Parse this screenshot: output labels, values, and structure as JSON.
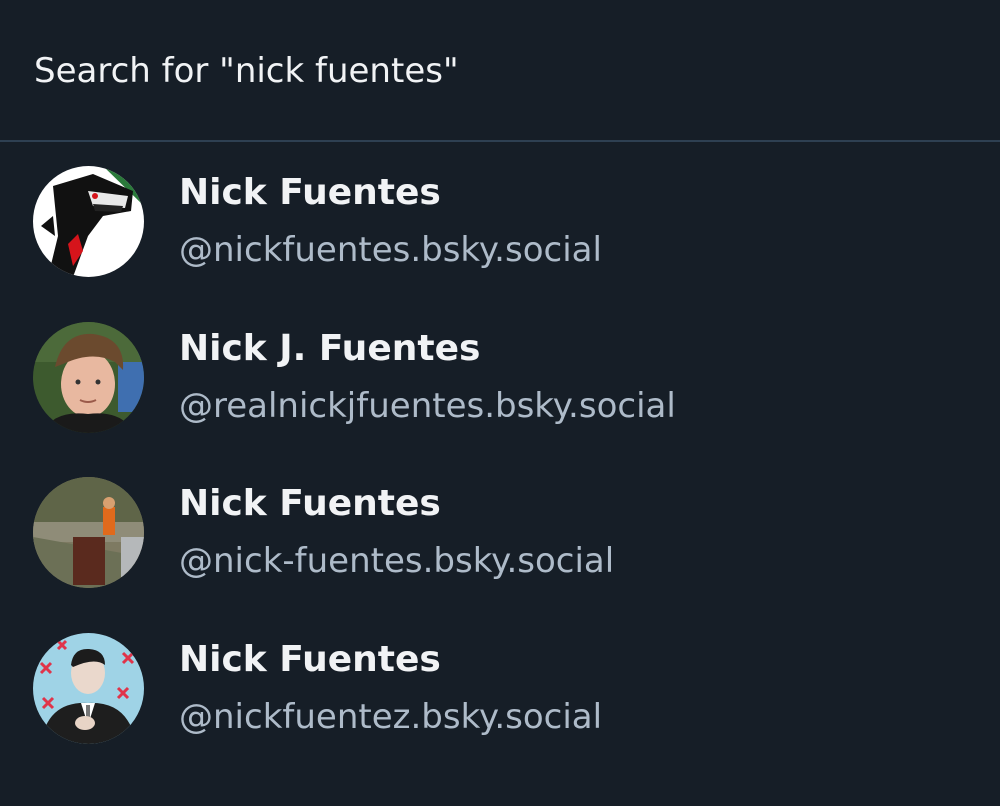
{
  "search": {
    "label": "Search for \"nick fuentes\""
  },
  "results": [
    {
      "name": "Nick Fuentes",
      "handle": "@nickfuentes.bsky.social",
      "avatar": "cartoon-wolf-avatar"
    },
    {
      "name": "Nick J. Fuentes",
      "handle": "@realnickjfuentes.bsky.social",
      "avatar": "portrait-photo-avatar"
    },
    {
      "name": "Nick Fuentes",
      "handle": "@nick-fuentes.bsky.social",
      "avatar": "outdoor-photo-avatar"
    },
    {
      "name": "Nick Fuentes",
      "handle": "@nickfuentez.bsky.social",
      "avatar": "suit-photo-avatar"
    }
  ],
  "colors": {
    "background": "#161e27",
    "divider": "#2e4052",
    "primary_text": "#f1f3f5",
    "secondary_text": "#aebbc9"
  }
}
